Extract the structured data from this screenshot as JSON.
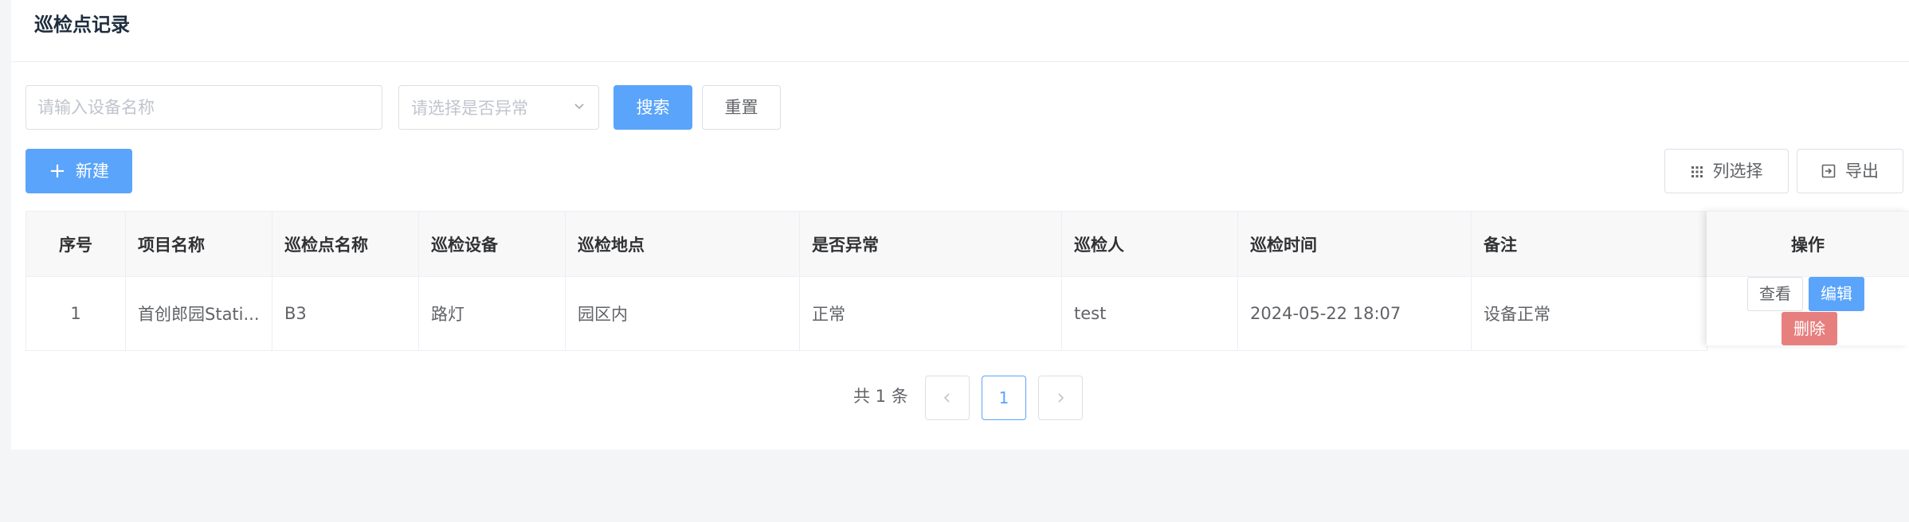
{
  "page": {
    "title": "巡检点记录"
  },
  "filters": {
    "device_placeholder": "请输入设备名称",
    "abnormal_placeholder": "请选择是否异常",
    "search_label": "搜索",
    "reset_label": "重置"
  },
  "toolbar": {
    "new_label": "新建",
    "columns_label": "列选择",
    "export_label": "导出"
  },
  "table": {
    "columns": [
      "序号",
      "项目名称",
      "巡检点名称",
      "巡检设备",
      "巡检地点",
      "是否异常",
      "巡检人",
      "巡检时间",
      "备注",
      "操作"
    ],
    "rows": [
      {
        "index": "1",
        "project": "首创郎园Stati...",
        "point": "B3",
        "device": "路灯",
        "location": "园区内",
        "abnormal": "正常",
        "inspector": "test",
        "time": "2024-05-22 18:07",
        "remark": "设备正常",
        "actions": {
          "view": "查看",
          "edit": "编辑",
          "delete": "删除"
        }
      }
    ]
  },
  "pagination": {
    "total_text": "共 1 条",
    "current_page": "1"
  },
  "colors": {
    "primary": "#5aa4fb",
    "danger": "#e77f7f"
  }
}
